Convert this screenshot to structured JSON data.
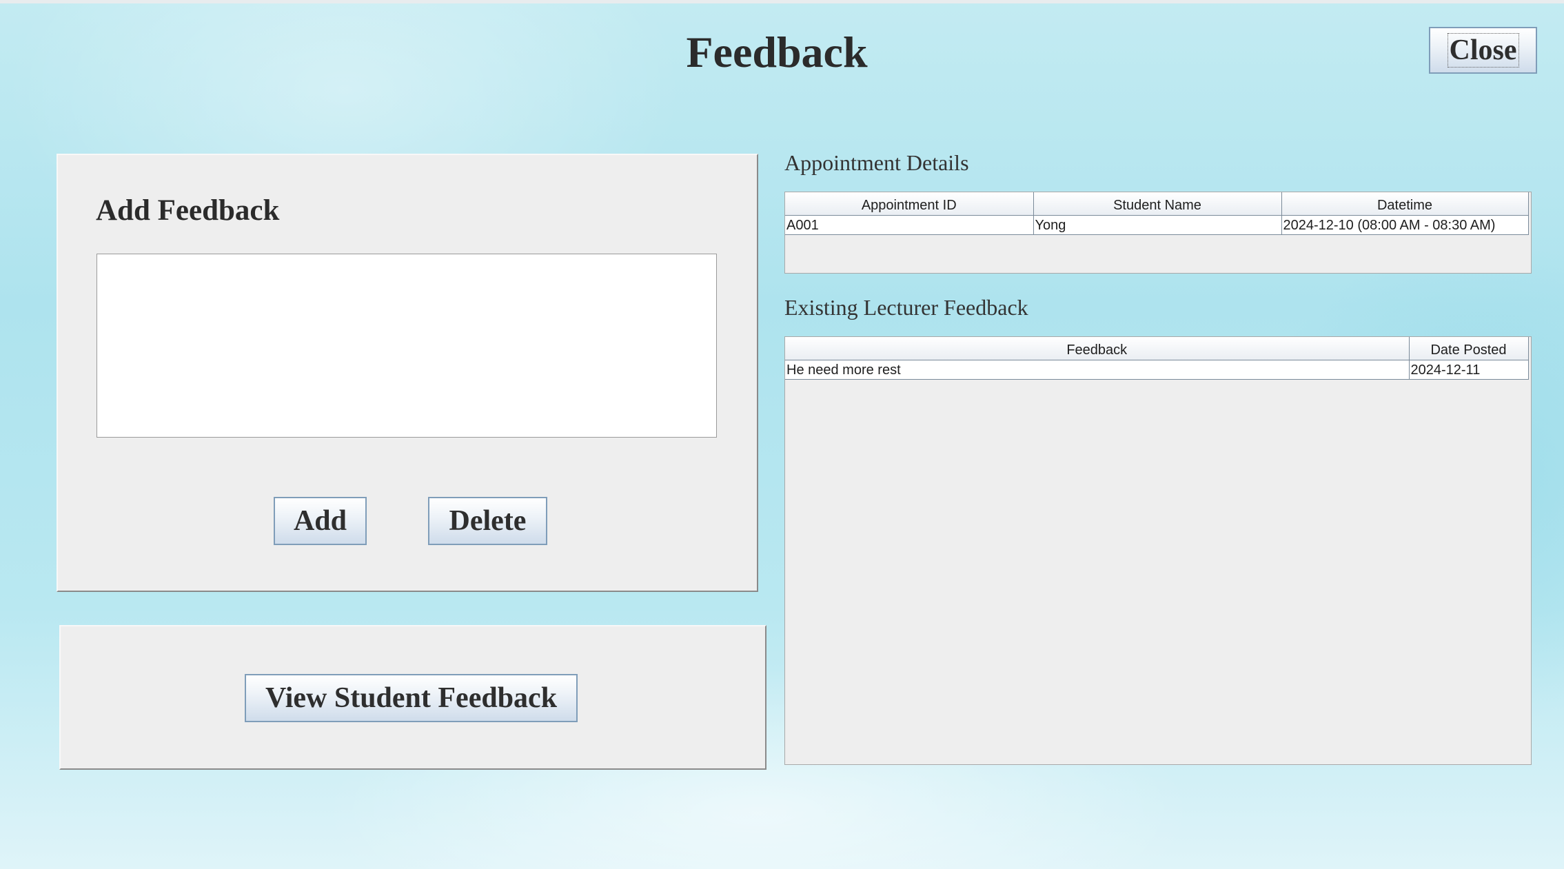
{
  "window": {
    "title": "Feedback",
    "close_label": "Close"
  },
  "add_feedback": {
    "title": "Add Feedback",
    "input_value": "",
    "add_label": "Add",
    "delete_label": "Delete"
  },
  "view": {
    "button_label": "View Student Feedback"
  },
  "appointment": {
    "title": "Appointment Details",
    "columns": [
      "Appointment ID",
      "Student Name",
      "Datetime"
    ],
    "rows": [
      [
        "A001",
        "Yong",
        "2024-12-10 (08:00 AM - 08:30 AM)"
      ]
    ]
  },
  "lecturer_feedback": {
    "title": "Existing Lecturer Feedback",
    "columns": [
      "Feedback",
      "Date Posted"
    ],
    "rows": [
      [
        "He need more rest",
        "2024-12-11"
      ]
    ]
  }
}
